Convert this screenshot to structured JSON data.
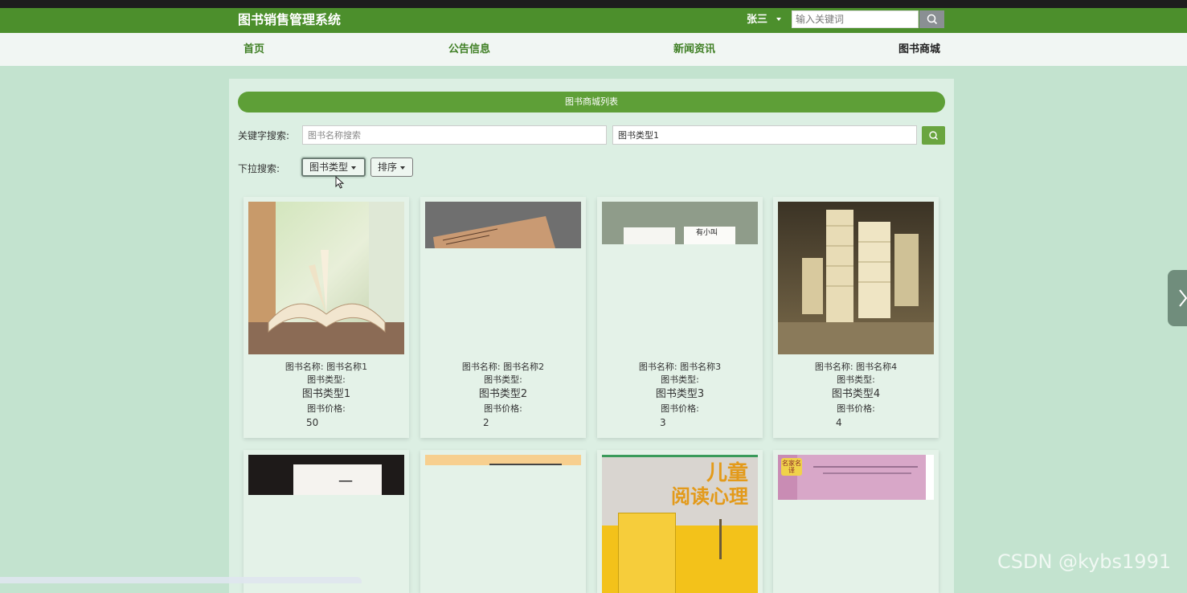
{
  "header": {
    "title": "图书销售管理系统",
    "user": "张三",
    "search_placeholder": "输入关键词"
  },
  "nav": [
    "首页",
    "公告信息",
    "新闻资讯",
    "图书商城"
  ],
  "panel": {
    "banner": "图书商城列表",
    "keyword_label": "关键字搜索:",
    "name_placeholder": "图书名称搜索",
    "type_value": "图书类型1",
    "dropdown_label": "下拉搜索:",
    "type_dropdown": "图书类型",
    "sort_dropdown": "排序"
  },
  "card_labels": {
    "name": "图书名称:",
    "type": "图书类型:",
    "price": "图书价格:"
  },
  "books": [
    {
      "name": "图书名称1",
      "type": "图书类型1",
      "price": "50"
    },
    {
      "name": "图书名称2",
      "type": "图书类型2",
      "price": "2"
    },
    {
      "name": "图书名称3",
      "type": "图书类型3",
      "price": "3"
    },
    {
      "name": "图书名称4",
      "type": "图书类型4",
      "price": "4"
    }
  ],
  "cover_text": {
    "book3": "有小叫",
    "book7_line1": "儿童",
    "book7_line2": "阅读心理",
    "book8_badge": "名家名译"
  },
  "watermark": "CSDN @kybs1991"
}
